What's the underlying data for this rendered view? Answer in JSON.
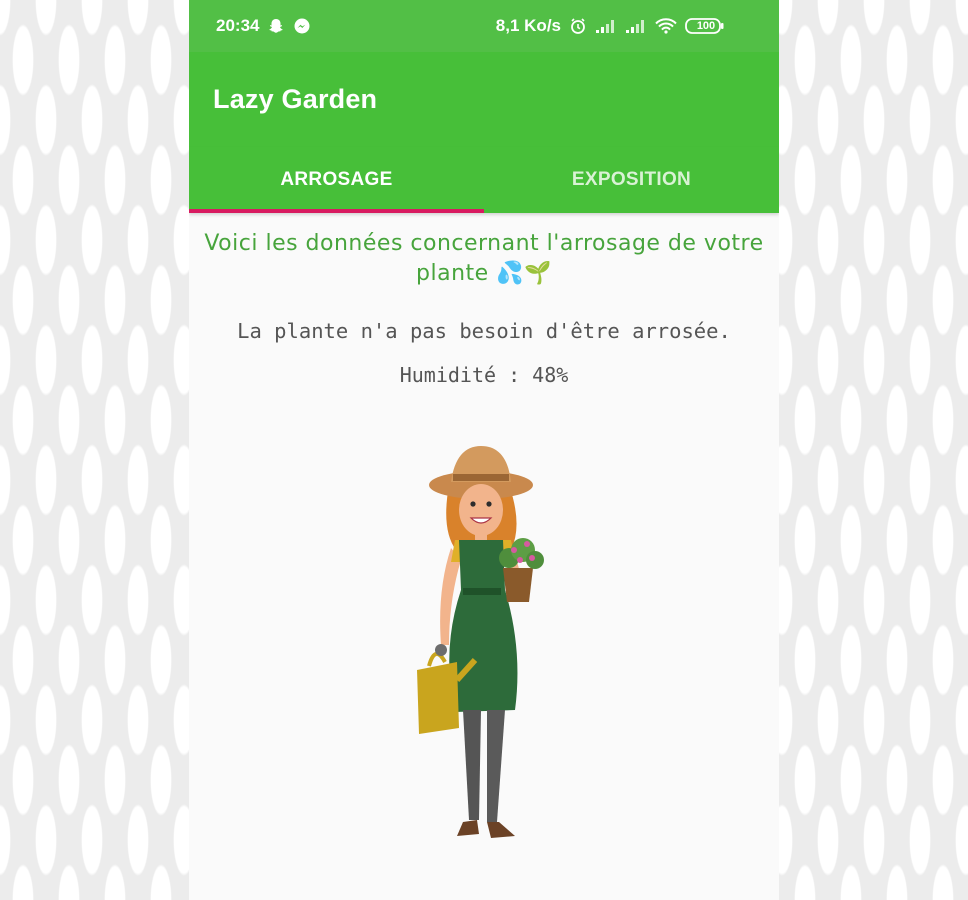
{
  "statusbar": {
    "time": "20:34",
    "speed": "8,1 Ko/s",
    "battery": "100",
    "icons": [
      "snapchat-icon",
      "messenger-icon",
      "alarm-icon",
      "signal-icon",
      "signal-icon",
      "wifi-icon",
      "battery-icon"
    ]
  },
  "appbar": {
    "title": "Lazy Garden"
  },
  "tabs": [
    {
      "label": "ARROSAGE",
      "selected": true
    },
    {
      "label": "EXPOSITION",
      "selected": false
    }
  ],
  "colors": {
    "primary": "#47bf39",
    "statusbar": "#52bf46",
    "accent": "#d81b60",
    "headline": "#47a43c"
  },
  "content": {
    "headline": "Voici les données concernant l'arrosage de votre plante 💦🌱",
    "status": "La plante n'a pas besoin d'être arrosée.",
    "humidity": "Humidité : 48%"
  },
  "illustration": {
    "icon": "gardener-illustration"
  }
}
